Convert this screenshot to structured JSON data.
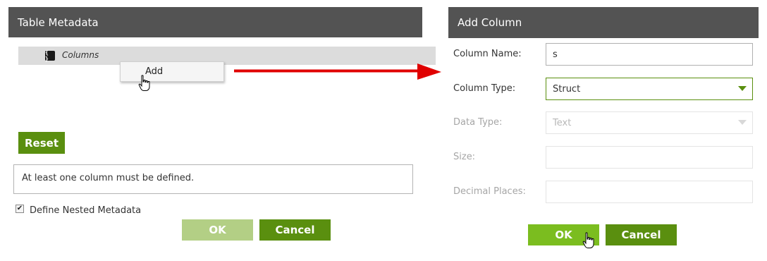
{
  "left_panel": {
    "title": "Table Metadata",
    "tree": {
      "label": "Columns",
      "icon": "json-object-icon",
      "icon_glyph": "{ }"
    },
    "context_menu": {
      "items": [
        "Add"
      ]
    },
    "reset_label": "Reset",
    "message": "At least one column must be defined.",
    "nested": {
      "label": "Define Nested Metadata",
      "checked": true,
      "check_glyph": "✔"
    },
    "ok_label": "OK",
    "cancel_label": "Cancel"
  },
  "right_panel": {
    "title": "Add Column",
    "fields": {
      "column_name": {
        "label": "Column Name:",
        "value": "s"
      },
      "column_type": {
        "label": "Column Type:",
        "value": "Struct"
      },
      "data_type": {
        "label": "Data Type:",
        "value": "Text",
        "disabled": true
      },
      "size": {
        "label": "Size:",
        "value": "",
        "disabled": true
      },
      "decimal_places": {
        "label": "Decimal Places:",
        "value": "",
        "disabled": true
      }
    },
    "ok_label": "OK",
    "cancel_label": "Cancel"
  },
  "colors": {
    "header_bg": "#535353",
    "primary_green": "#5a8f0f",
    "light_green": "#7bbd1f",
    "disabled_green": "#b3cf85",
    "arrow_red": "#e00000"
  }
}
